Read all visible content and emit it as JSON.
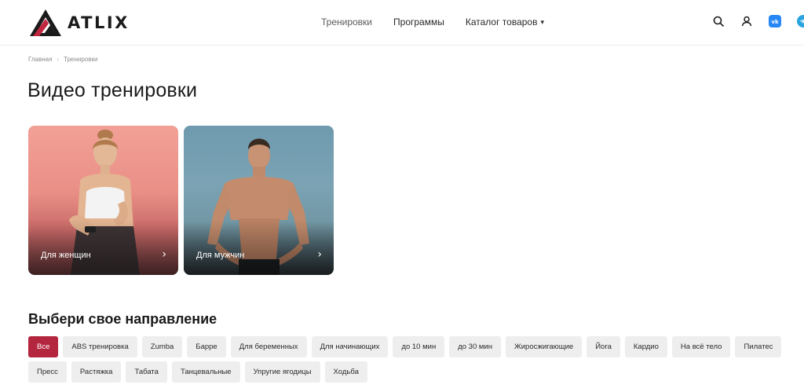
{
  "header": {
    "logo_text": "ATLIX",
    "nav": [
      {
        "label": "Тренировки"
      },
      {
        "label": "Программы"
      },
      {
        "label": "Каталог товаров"
      }
    ],
    "icons": [
      "search-icon",
      "user-icon",
      "vk-icon",
      "telegram-icon"
    ]
  },
  "breadcrumb": {
    "home": "Главная",
    "current": "Тренировки"
  },
  "page_title": "Видео тренировки",
  "cards": [
    {
      "label": "Для женщин",
      "arrow": "›"
    },
    {
      "label": "Для мужчин",
      "arrow": "›"
    }
  ],
  "section_title": "Выбери свое направление",
  "chips": [
    "Все",
    "ABS тренировка",
    "Zumba",
    "Барре",
    "Для беременных",
    "Для начинающих",
    "до 10 мин",
    "до 30 мин",
    "Жиросжигающие",
    "Йога",
    "Кардио",
    "На всё тело",
    "Пилатес",
    "Пресс",
    "Растяжка",
    "Табата",
    "Танцевальные",
    "Упругие ягодицы",
    "Ходьба"
  ],
  "active_chip": "Все",
  "colors": {
    "accent": "#b4253e",
    "chip_bg": "#eeeeee",
    "vk": "#2787f5",
    "telegram": "#2aa3df"
  }
}
